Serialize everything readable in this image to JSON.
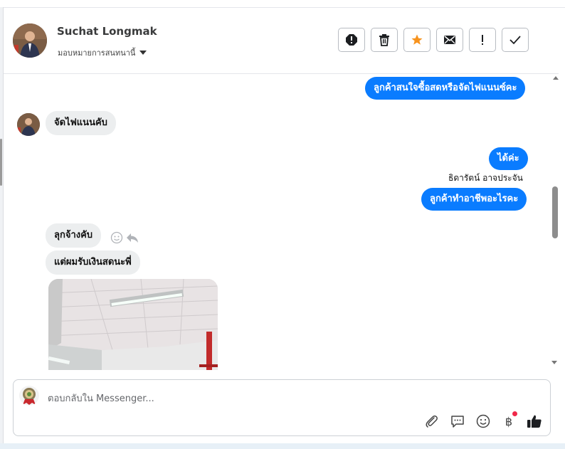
{
  "contact": {
    "name": "Suchat Longmak",
    "assign_label": "มอบหมายการสนทนานี้"
  },
  "actions": [
    {
      "icon": "report-icon"
    },
    {
      "icon": "trash-icon"
    },
    {
      "icon": "star-icon"
    },
    {
      "icon": "mail-icon"
    },
    {
      "icon": "exclamation-icon"
    },
    {
      "icon": "check-icon"
    }
  ],
  "messages": {
    "out1": "ลูกค้าสนใจซื้อสดหรือจัดไฟแนนซ์คะ",
    "in1": "จัดไฟแนนคับ",
    "out2": "ได้ค่ะ",
    "out2_sender": "ธิดารัตน์ อาจประจัน",
    "out3": "ลูกค้าทำอาชีพอะไรคะ",
    "in2": "ลุกจ้างคับ",
    "in3": "แต่ผมรับเงินสดนะพี่"
  },
  "composer": {
    "placeholder": "ตอบกลับใน Messenger...",
    "tools": [
      "attach-icon",
      "chat-icon",
      "emoji-icon",
      "baht-icon",
      "like-icon"
    ],
    "baht_symbol": "฿"
  },
  "colors": {
    "outgoing_bubble": "#0a7cff",
    "incoming_bubble": "#eceeef",
    "star": "#f7931e",
    "notification_dot": "#f02849"
  }
}
